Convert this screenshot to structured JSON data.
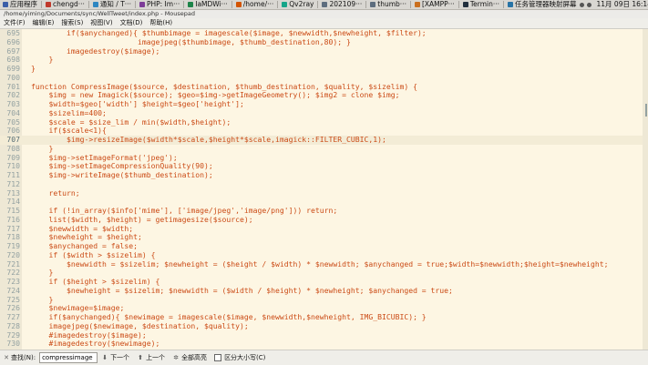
{
  "taskbar": {
    "items": [
      {
        "label": "应用程序",
        "color": "#3b5ea8"
      },
      {
        "label": "chengd···",
        "color": "#c0392b"
      },
      {
        "label": "通知 / T···",
        "color": "#2e86c1"
      },
      {
        "label": "PHP: Im···",
        "color": "#7d3c98"
      },
      {
        "label": "IaMDWi···",
        "color": "#1e8449"
      },
      {
        "label": "/home/···",
        "color": "#d35400"
      },
      {
        "label": "Qv2ray",
        "color": "#17a589"
      },
      {
        "label": "202109···",
        "color": "#5d6d7e"
      },
      {
        "label": "thumb···",
        "color": "#5d6d7e"
      },
      {
        "label": "[XAMPP···",
        "color": "#ca6f1e"
      },
      {
        "label": "Termin···",
        "color": "#212f3d"
      },
      {
        "label": "任务管理器映射屏幕",
        "color": "#2874a6"
      }
    ],
    "clock": "11月 09日 16:14"
  },
  "window_path": "/home/yiming/Documents/sync/WellTweet/index.php - Mousepad",
  "menu": [
    "文件(F)",
    "编辑(E)",
    "搜索(S)",
    "视图(V)",
    "文档(D)",
    "帮助(H)"
  ],
  "current_line": "707",
  "lines": [
    {
      "n": "695",
      "t": "        if($anychanged){ $thumbimage = imagescale($image, $newwidth,$newheight, $filter);"
    },
    {
      "n": "696",
      "t": "                        imagejpeg($thumbimage, $thumb_destination,80); }"
    },
    {
      "n": "697",
      "t": "        imagedestroy($image);"
    },
    {
      "n": "698",
      "t": "    }"
    },
    {
      "n": "699",
      "t": "}"
    },
    {
      "n": "700",
      "t": ""
    },
    {
      "n": "701",
      "t": "function CompressImage($source, $destination, $thumb_destination, $quality, $sizelim) {"
    },
    {
      "n": "702",
      "t": "    $img = new Imagick($source); $geo=$img->getImageGeometry(); $img2 = clone $img;"
    },
    {
      "n": "703",
      "t": "    $width=$geo['width'] $height=$geo['height'];"
    },
    {
      "n": "704",
      "t": "    $sizelim=400;"
    },
    {
      "n": "705",
      "t": "    $scale = $size_lim / min($width,$height);"
    },
    {
      "n": "706",
      "t": "    if($scale<1){"
    },
    {
      "n": "707",
      "t": "        $img->resizeImage($width*$scale,$height*$scale,imagick::FILTER_CUBIC,1);"
    },
    {
      "n": "708",
      "t": "    }"
    },
    {
      "n": "709",
      "t": "    $img->setImageFormat('jpeg');"
    },
    {
      "n": "710",
      "t": "    $img->setImageCompressionQuality(90);"
    },
    {
      "n": "711",
      "t": "    $img->writeImage($thumb_destination);"
    },
    {
      "n": "712",
      "t": ""
    },
    {
      "n": "713",
      "t": "    return;"
    },
    {
      "n": "714",
      "t": ""
    },
    {
      "n": "715",
      "t": "    if (!in_array($info['mime'], ['image/jpeg','image/png'])) return;"
    },
    {
      "n": "716",
      "t": "    list($width, $height) = getimagesize($source);"
    },
    {
      "n": "717",
      "t": "    $newwidth = $width;"
    },
    {
      "n": "718",
      "t": "    $newheight = $height;"
    },
    {
      "n": "719",
      "t": "    $anychanged = false;"
    },
    {
      "n": "720",
      "t": "    if ($width > $sizelim) {"
    },
    {
      "n": "721",
      "t": "        $newwidth = $sizelim; $newheight = ($height / $width) * $newwidth; $anychanged = true;$width=$newwidth;$height=$newheight;"
    },
    {
      "n": "722",
      "t": "    }"
    },
    {
      "n": "723",
      "t": "    if ($height > $sizelim) {"
    },
    {
      "n": "724",
      "t": "        $newheight = $sizelim; $newwidth = ($width / $height) * $newheight; $anychanged = true;"
    },
    {
      "n": "725",
      "t": "    }"
    },
    {
      "n": "726",
      "t": "    $newimage=$image;"
    },
    {
      "n": "727",
      "t": "    if($anychanged){ $newimage = imagescale($image, $newwidth,$newheight, IMG_BICUBIC); }"
    },
    {
      "n": "728",
      "t": "    imagejpeg($newimage, $destination, $quality);"
    },
    {
      "n": "729",
      "t": "    #imagedestroy($image);"
    },
    {
      "n": "730",
      "t": "    #imagedestroy($newimage);"
    }
  ],
  "findbar": {
    "label": "查找(N):",
    "value": "compressimage",
    "next": "下一个",
    "prev": "上一个",
    "highlight_all": "全部高亮",
    "match_case": "区分大小写(C)"
  },
  "colors": {
    "code": "#cb4b16",
    "background": "#fdf6e3",
    "line_number": "#93a1a1"
  }
}
